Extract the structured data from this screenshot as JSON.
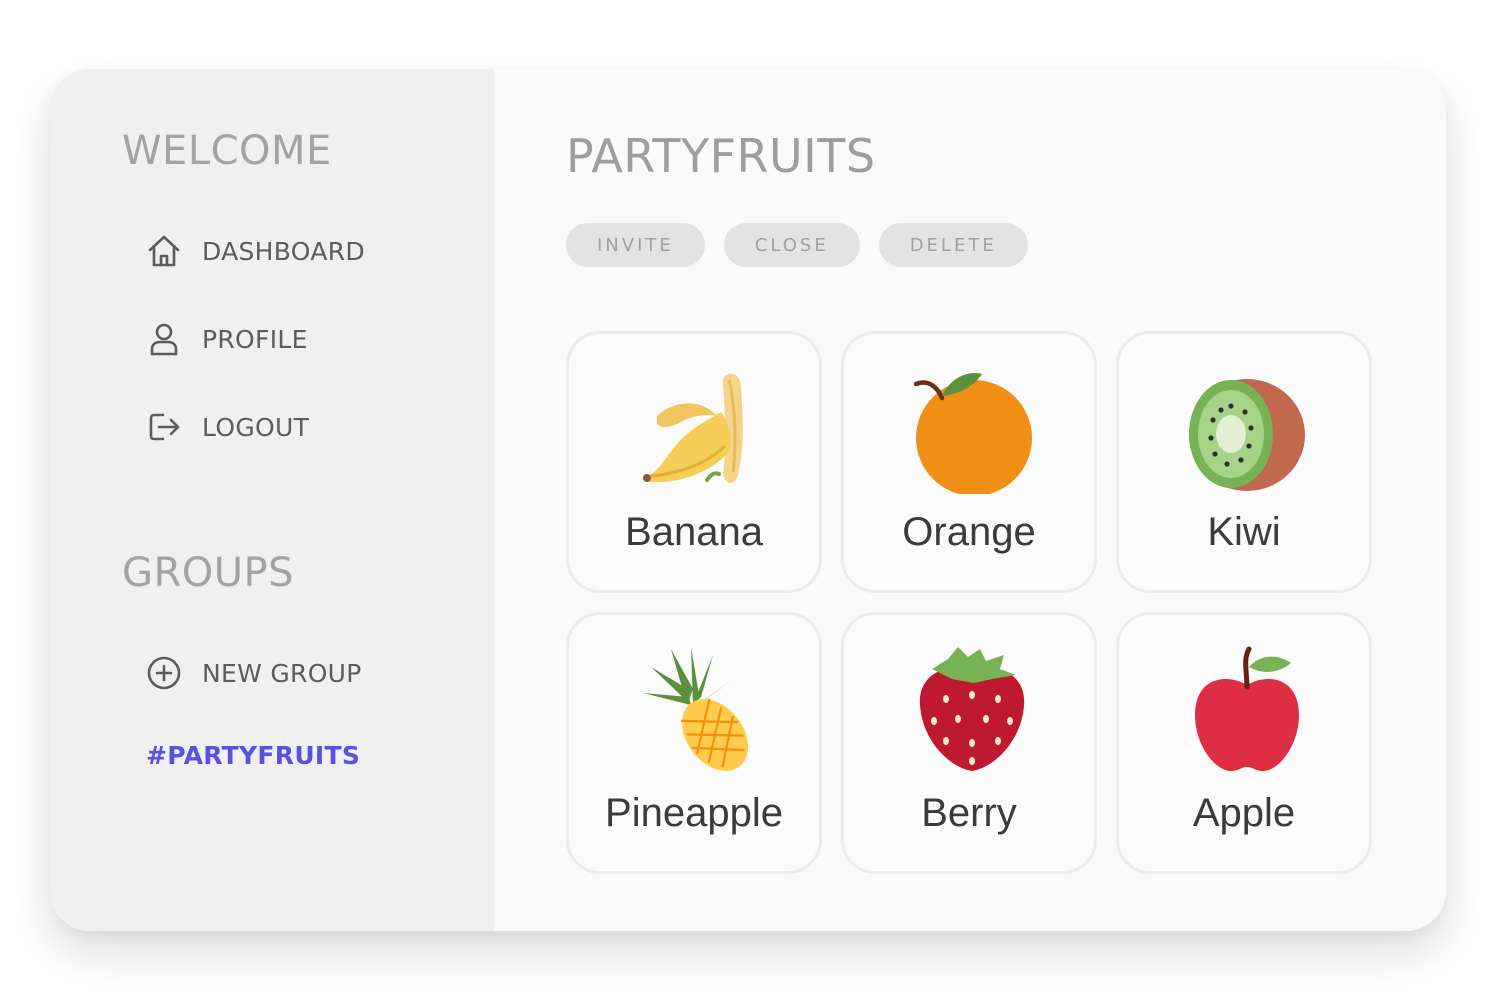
{
  "sidebar": {
    "welcome_title": "WELCOME",
    "nav": [
      {
        "label": "DASHBOARD",
        "icon": "home-icon"
      },
      {
        "label": "PROFILE",
        "icon": "user-icon"
      },
      {
        "label": "LOGOUT",
        "icon": "logout-icon"
      }
    ],
    "groups_title": "GROUPS",
    "new_group": {
      "label": "NEW GROUP",
      "icon": "plus-circle-icon"
    },
    "active_group": {
      "label": "#PARTYFRUITS",
      "color": "#5a50e6"
    }
  },
  "main": {
    "title": "PARTYFRUITS",
    "actions": [
      "INVITE",
      "CLOSE",
      "DELETE"
    ],
    "items": [
      {
        "label": "Banana",
        "icon": "banana-icon"
      },
      {
        "label": "Orange",
        "icon": "orange-icon"
      },
      {
        "label": "Kiwi",
        "icon": "kiwi-icon"
      },
      {
        "label": "Pineapple",
        "icon": "pineapple-icon"
      },
      {
        "label": "Berry",
        "icon": "strawberry-icon"
      },
      {
        "label": "Apple",
        "icon": "apple-icon"
      }
    ]
  },
  "colors": {
    "sidebar_bg": "#f0f0f0",
    "main_bg": "#fafafa",
    "accent": "#5a50e6",
    "button_bg": "#e3e3e3",
    "muted_text": "#a3a3a3"
  }
}
